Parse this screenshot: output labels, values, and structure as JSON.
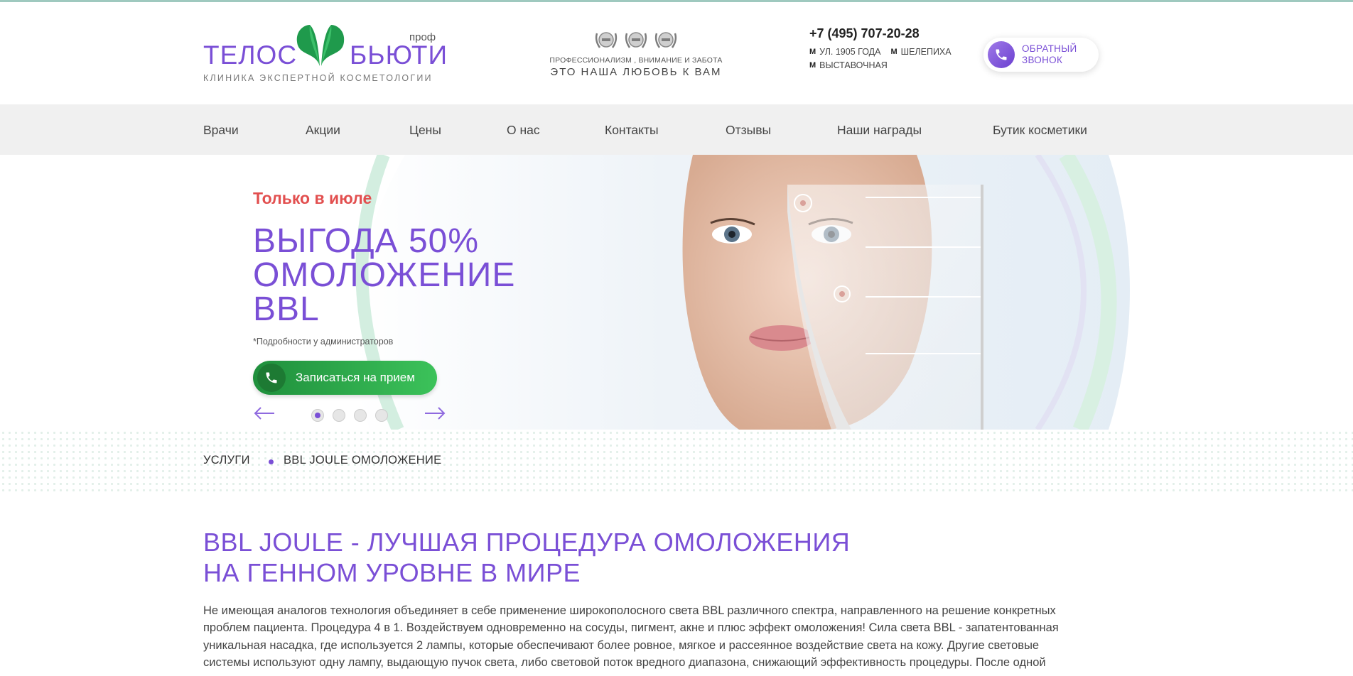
{
  "header": {
    "logo": {
      "left": "ТЕЛОС",
      "right": "БЬЮТИ",
      "prof": "проф",
      "subtitle": "КЛИНИКА ЭКСПЕРТНОЙ КОСМЕТОЛОГИИ"
    },
    "slogan": {
      "small": "ПРОФЕССИОНАЛИЗМ , ВНИМАНИЕ И ЗАБОТА",
      "big": "ЭТО НАША ЛЮБОВЬ К ВАМ"
    },
    "phone": "+7 (495) 707-20-28",
    "metro": [
      "УЛ. 1905 ГОДА",
      "ШЕЛЕПИХА",
      "ВЫСТАВОЧНАЯ"
    ],
    "callback": {
      "line1": "ОБРАТНЫЙ",
      "line2": "ЗВОНОК"
    }
  },
  "nav": [
    "Врачи",
    "Акции",
    "Цены",
    "О нас",
    "Контакты",
    "Отзывы",
    "Наши награды",
    "Бутик косметики"
  ],
  "banner": {
    "month": "Только в июле",
    "title_lines": [
      "ВЫГОДА 50%",
      "ОМОЛОЖЕНИЕ",
      "BBL"
    ],
    "note": "*Подробности у администраторов",
    "button": "Записаться на прием",
    "active_slide": 1,
    "slide_count": 4
  },
  "breadcrumbs": [
    "УСЛУГИ",
    "BBL JOULE ОМОЛОЖЕНИЕ"
  ],
  "content": {
    "title_lines": [
      "BBL JOULE - ЛУЧШАЯ ПРОЦЕДУРА ОМОЛОЖЕНИЯ",
      "НА ГЕННОМ УРОВНЕ В МИРЕ"
    ],
    "text_lines": [
      "Не имеющая аналогов технология объединяет в себе применение широкополосного света BBL различного спектра, направленного на решение конкретных",
      "проблем пациента. Процедура 4 в 1. Воздействуем одновременно на сосуды, пигмент, акне и плюс эффект омоложения! Сила света BBL - запатентованная",
      "уникальная насадка, где используется 2 лампы, которые обеспечивают более ровное, мягкое и рассеянное воздействие света на кожу. Другие световые",
      "системы используют одну лампу, выдающую пучок света, либо световой поток вредного диапазона, снижающий эффективность процедуры. После одной"
    ]
  },
  "colors": {
    "accent": "#7a4fd6",
    "promo_red": "#e24f4f",
    "green": "#2fae4b",
    "nav_bg": "#f0f0f0"
  }
}
